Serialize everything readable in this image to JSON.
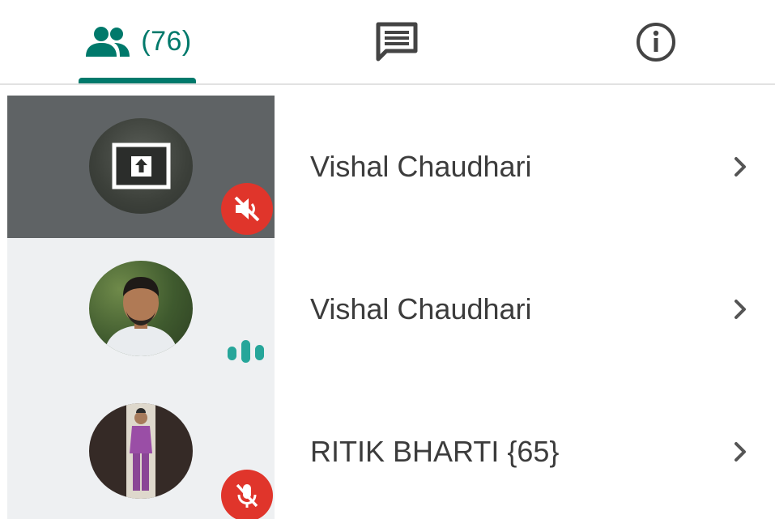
{
  "tabs": {
    "participants_count": "(76)",
    "active": "participants"
  },
  "participants": [
    {
      "name": "Vishal Chaudhari",
      "status": "presenting",
      "audio": "muted"
    },
    {
      "name": "Vishal Chaudhari",
      "status": "camera",
      "audio": "speaking"
    },
    {
      "name": "RITIK BHARTI {65}",
      "status": "camera",
      "audio": "mic-off"
    }
  ],
  "colors": {
    "accent": "#00796b",
    "muted": "#e0352b",
    "presenting_bg": "#5f6365"
  }
}
